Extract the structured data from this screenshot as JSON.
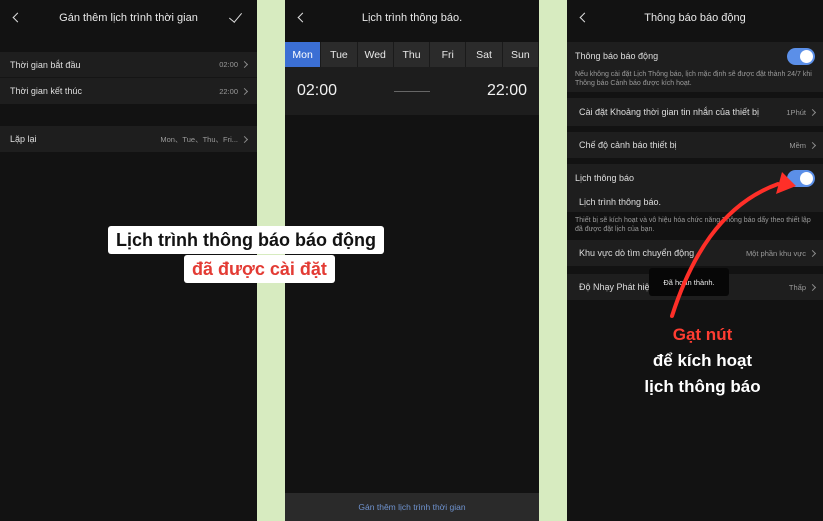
{
  "screen1": {
    "title": "Gán thêm lịch trình thời  gian",
    "rows": [
      {
        "label": "Thời gian bắt đầu",
        "value": "02:00"
      },
      {
        "label": "Thời gian kết thúc",
        "value": "22:00"
      }
    ],
    "repeat": {
      "label": "Lặp lại",
      "value": "Mon、Tue、Thu、Fri..."
    }
  },
  "screen2": {
    "title": "Lịch trình thông báo.",
    "days": [
      "Mon",
      "Tue",
      "Wed",
      "Thu",
      "Fri",
      "Sat",
      "Sun"
    ],
    "active_day": "Mon",
    "start": "02:00",
    "end": "22:00",
    "bottom_button": "Gán thêm lịch trình thời  gian"
  },
  "screen3": {
    "title": "Thông báo báo động",
    "alarm_notify": {
      "label": "Thông báo báo động",
      "on": true
    },
    "alarm_desc": "Nếu không cài đặt Lịch Thông báo, lịch mặc định sẽ được đặt thành 24/7 khi Thông báo Cảnh báo được kích hoạt.",
    "interval": {
      "label": "Cài đặt Khoảng thời gian tin nhắn của thiết bị",
      "value": "1Phút"
    },
    "alert_mode": {
      "label": "Chế độ cảnh báo thiết bị",
      "value": "Mềm"
    },
    "schedule_notify": {
      "label": "Lịch thông báo",
      "on": true
    },
    "schedule_sub": "Lịch trình thông báo.",
    "schedule_desc": "Thiết bị sẽ kích hoạt và vô hiệu hóa chức năng Thông báo dẩy theo thiết lập đã được đặt lịch của bạn.",
    "motion_area": {
      "label": "Khu vực dò tìm chuyển động",
      "value": "Một phần khu vực"
    },
    "sensitivity": {
      "label": "Độ Nhạy Phát hiện Chuyển động",
      "value": "Thấp"
    },
    "toast": "Đã hoàn thành."
  },
  "overlay1": {
    "line1": "Lịch trình thông báo báo động",
    "line2": "đã được cài đặt"
  },
  "overlay3": {
    "line1": "Gạt nút",
    "line2": "để kích hoạt",
    "line3": "lịch thông báo"
  },
  "colors": {
    "accent": "#3b6fd4",
    "toggle": "#5b8fe8",
    "overlay_red": "#e33b34",
    "divider_green": "#d7ebc0"
  }
}
